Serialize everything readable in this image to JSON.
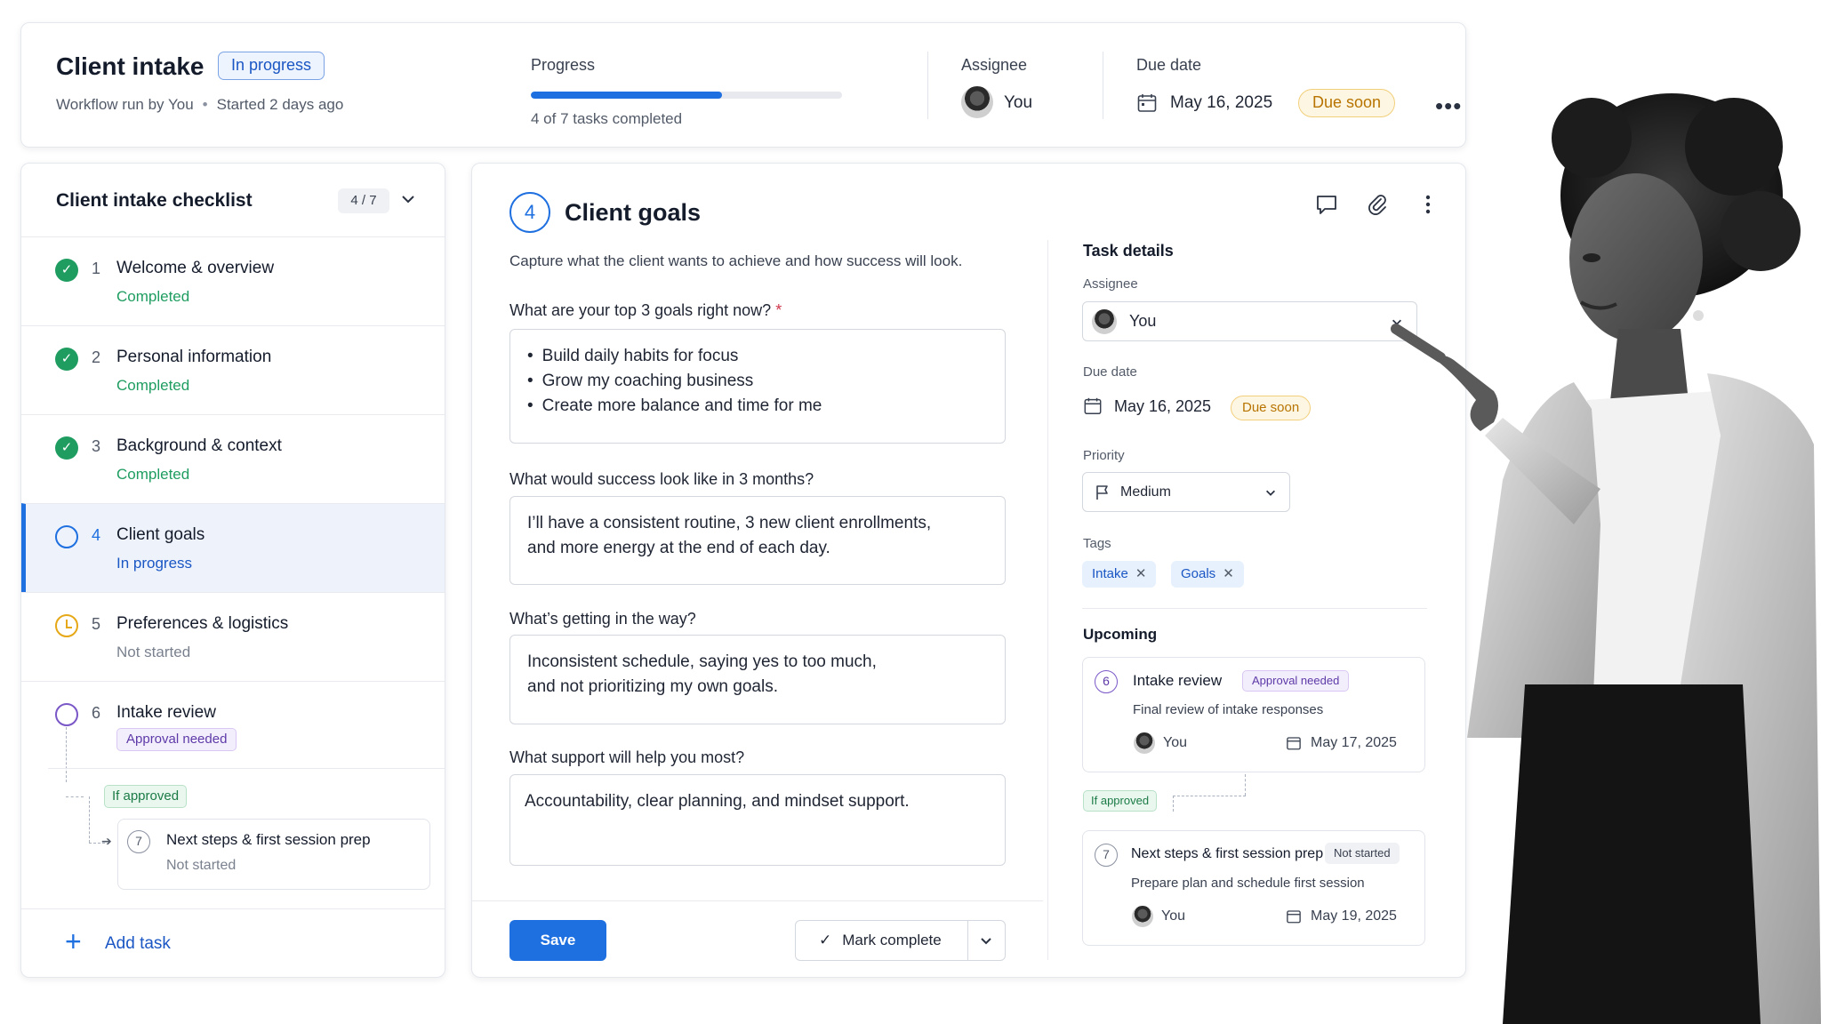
{
  "header": {
    "title": "Client intake",
    "status": "In progress",
    "run_by": "Workflow run by You",
    "started": "Started 2 days ago",
    "progress_label": "Progress",
    "progress_fraction": 0.615,
    "progress_text": "4 of 7 tasks completed",
    "assignee_label": "Assignee",
    "assignee": "You",
    "due_label": "Due date",
    "due_date": "May 16, 2025",
    "due_badge": "Due soon"
  },
  "checklist": {
    "title": "Client intake checklist",
    "count": "4 / 7",
    "items": [
      {
        "num": "1",
        "name": "Welcome & overview",
        "status": "Completed"
      },
      {
        "num": "2",
        "name": "Personal information",
        "status": "Completed"
      },
      {
        "num": "3",
        "name": "Background & context",
        "status": "Completed"
      },
      {
        "num": "4",
        "name": "Client goals",
        "status": "In progress"
      },
      {
        "num": "5",
        "name": "Preferences & logistics",
        "status": "Not started"
      },
      {
        "num": "6",
        "name": "Intake review",
        "status": "Approval needed"
      }
    ],
    "branch_label": "If approved",
    "sub_item": {
      "num": "7",
      "name": "Next steps & first session prep",
      "status": "Not started"
    },
    "add_task": "Add task"
  },
  "main": {
    "step": "4",
    "title": "Client goals",
    "description": "Capture what the client wants to achieve and how success will look.",
    "questions": [
      {
        "label": "What are your top 3 goals right now?",
        "required": "*",
        "bullets": [
          "Build daily habits for focus",
          "Grow my coaching business",
          "Create more balance and time for me"
        ]
      },
      {
        "label": "What would success look like in 3 months?",
        "lines": [
          "I’ll have a consistent routine, 3 new client enrollments,",
          "and more energy at the end of each day."
        ]
      },
      {
        "label": "What’s getting in the way?",
        "lines": [
          "Inconsistent schedule, saying yes to too much,",
          "and not prioritizing my own goals."
        ]
      },
      {
        "label": "What support will help you most?",
        "lines": [
          "Accountability, clear planning, and mindset support."
        ]
      }
    ],
    "save": "Save",
    "mark_complete": "Mark complete"
  },
  "details": {
    "title": "Task details",
    "assignee_label": "Assignee",
    "assignee": "You",
    "due_label": "Due date",
    "due_date": "May 16, 2025",
    "due_badge": "Due soon",
    "priority_label": "Priority",
    "priority": "Medium",
    "tags_label": "Tags",
    "tags": [
      "Intake",
      "Goals"
    ],
    "upcoming_label": "Upcoming",
    "upcoming": [
      {
        "num": "6",
        "name": "Intake review",
        "badge": "Approval needed",
        "desc": "Final review of intake responses",
        "assignee": "You",
        "date": "May 17, 2025"
      },
      {
        "num": "7",
        "name": "Next steps & first session prep",
        "badge": "Not started",
        "desc": "Prepare plan and schedule first session",
        "assignee": "You",
        "date": "May 19, 2025"
      }
    ],
    "branch_label": "If approved"
  },
  "colors": {
    "accent": "#1e6fe0",
    "success": "#1f9d61",
    "warning": "#e6a817",
    "purple": "#7a57c7"
  }
}
